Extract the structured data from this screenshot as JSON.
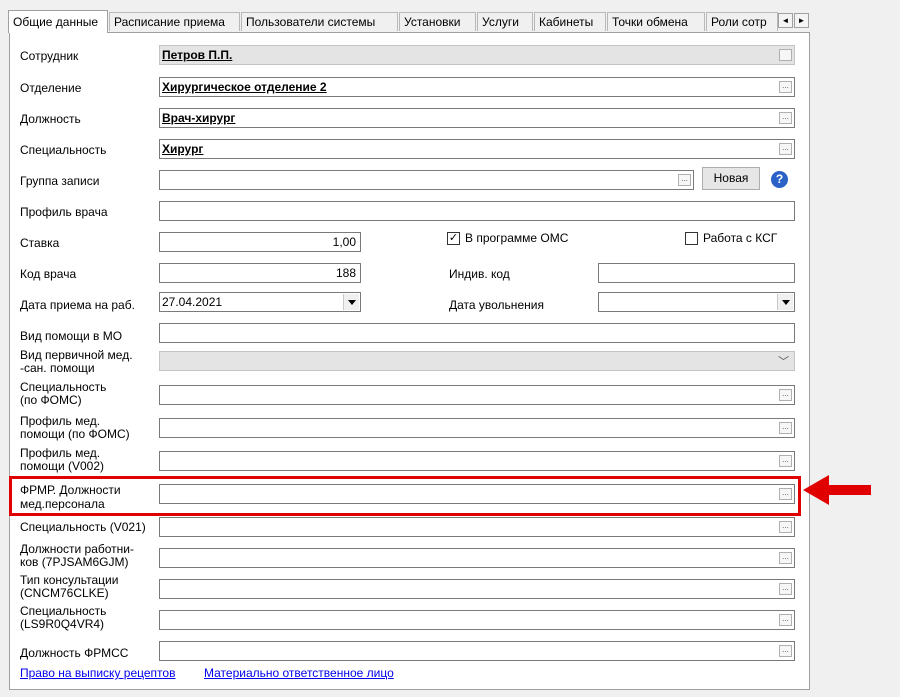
{
  "tabs": [
    "Общие данные",
    "Расписание приема",
    "Пользователи системы",
    "Установки",
    "Услуги",
    "Кабинеты",
    "Точки обмена",
    "Роли сотр"
  ],
  "tab_scroll": {
    "left": "◄",
    "right": "►"
  },
  "form": {
    "employee": {
      "label": "Сотрудник",
      "value": "Петров П.П."
    },
    "department": {
      "label": "Отделение",
      "value": "Хирургическое отделение 2"
    },
    "position": {
      "label": "Должность",
      "value": "Врач-хирург"
    },
    "specialty": {
      "label": "Специальность",
      "value": "Хирург"
    },
    "record_group": {
      "label": "Группа записи",
      "value": ""
    },
    "new_button": "Новая",
    "help_icon": "?",
    "doctor_profile": {
      "label": "Профиль врача",
      "value": ""
    },
    "rate": {
      "label": "Ставка",
      "value": "1,00"
    },
    "oms_checkbox": {
      "label": "В программе ОМС",
      "checked": true
    },
    "ksg_checkbox": {
      "label": "Работа с КСГ",
      "checked": false
    },
    "doctor_code": {
      "label": "Код врача",
      "value": "188"
    },
    "individual_code": {
      "label": "Индив. код",
      "value": ""
    },
    "hire_date": {
      "label": "Дата приема на раб.",
      "value": "27.04.2021"
    },
    "dismissal_date": {
      "label": "Дата увольнения",
      "value": ""
    },
    "aid_type_mo": {
      "label": "Вид помощи в МО",
      "value": ""
    },
    "primary_aid_type": {
      "label_1": "Вид первичной мед.",
      "label_2": "-сан. помощи",
      "value": ""
    },
    "specialty_foms": {
      "label_1": "Специальность",
      "label_2": "(по ФОМС)",
      "value": ""
    },
    "aid_profile_foms": {
      "label_1": "Профиль  мед.",
      "label_2": "помощи (по ФОМС)",
      "value": ""
    },
    "aid_profile_v002": {
      "label_1": "Профиль  мед.",
      "label_2": "помощи (V002)",
      "value": ""
    },
    "frmr_position": {
      "label_1": "ФРМР. Должности",
      "label_2": "мед.персонала",
      "value": ""
    },
    "specialty_v021": {
      "label": "Специальность (V021)",
      "value": ""
    },
    "worker_positions": {
      "label_1": "Должности работни-",
      "label_2": "ков (7PJSAM6GJM)",
      "value": ""
    },
    "consultation_type": {
      "label_1": "Тип консультации",
      "label_2": "(CNCM76CLKE)",
      "value": ""
    },
    "specialty_ls9": {
      "label_1": "Специальность",
      "label_2": "(LS9R0Q4VR4)",
      "value": ""
    },
    "frmss_position": {
      "label": "Должность ФРМСС",
      "value": ""
    }
  },
  "ellipsis": "...",
  "links": {
    "prescription_right": "Право на выписку рецептов",
    "responsible_person": "Материально ответственное лицо"
  },
  "colors": {
    "highlight": "#e00000",
    "link": "#0000ee",
    "help": "#2a62c8"
  }
}
